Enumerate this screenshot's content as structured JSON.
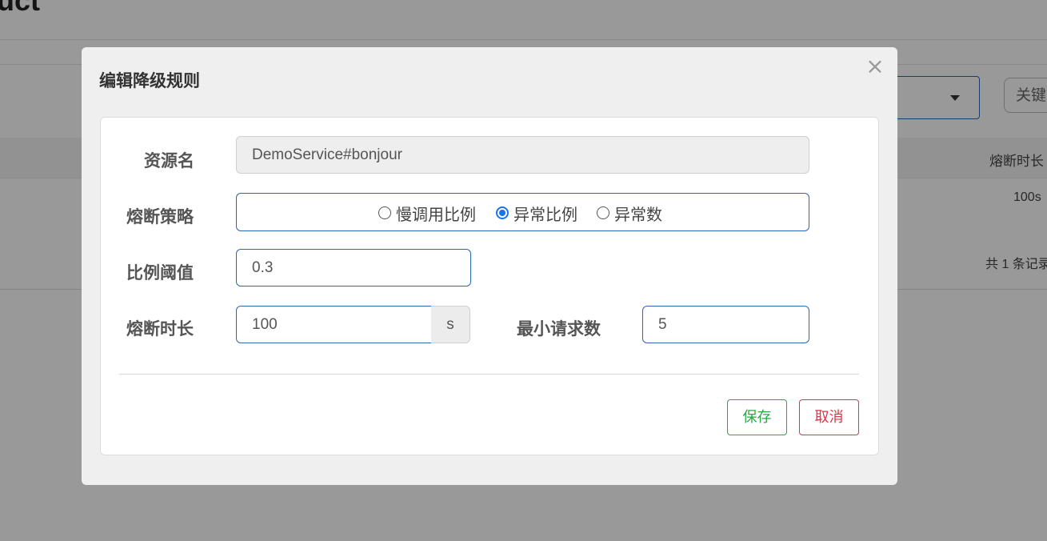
{
  "background": {
    "title": "uct",
    "keyword_placeholder": "关键",
    "column_header": "熔断时长",
    "cell_value": "100s",
    "total_text": "共 1 条记录"
  },
  "modal": {
    "title": "编辑降级规则",
    "close_symbol": "×",
    "fields": {
      "resource_label": "资源名",
      "resource_value": "DemoService#bonjour",
      "strategy_label": "熔断策略",
      "strategy_options": [
        "慢调用比例",
        "异常比例",
        "异常数"
      ],
      "strategy_selected": "异常比例",
      "ratio_label": "比例阈值",
      "ratio_value": "0.3",
      "duration_label": "熔断时长",
      "duration_value": "100",
      "duration_unit": "s",
      "min_request_label": "最小请求数",
      "min_request_value": "5"
    },
    "buttons": {
      "save": "保存",
      "cancel": "取消"
    }
  },
  "colors": {
    "primary_border": "#2b66b8",
    "save": "#28a745",
    "cancel": "#dc3545",
    "radio_checked": "#1a73e8"
  }
}
